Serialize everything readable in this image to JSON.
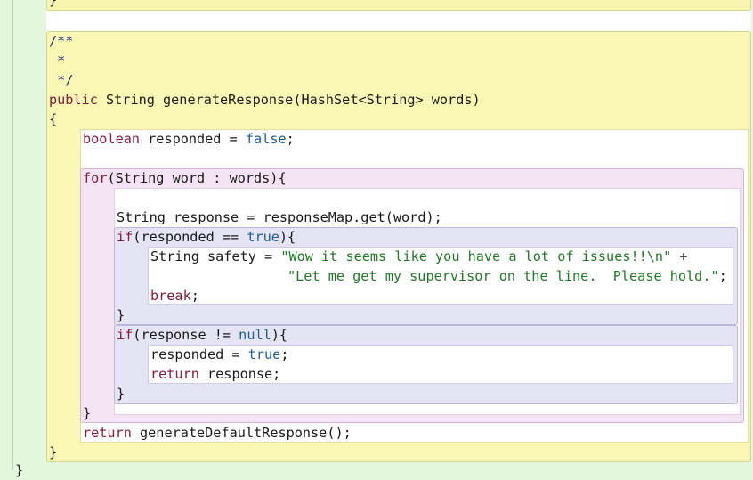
{
  "editor": {
    "prev_close_brace": "}",
    "comment_open": "/**",
    "comment_mid": " *",
    "comment_close": " */",
    "sig_public": "public",
    "sig_rest": " String generateResponse(HashSet<String> words)",
    "method_open": "{",
    "l1_kw": "boolean",
    "l1_mid": " responded = ",
    "l1_lit": "false",
    "l1_end": ";",
    "for_kw": "for",
    "for_rest": "(String word : words){",
    "resp_line": "String response = responseMap.get(word);",
    "if1_kw": "if",
    "if1_mid": "(responded == ",
    "if1_lit": "true",
    "if1_end": "){",
    "safety_pre": "String safety = ",
    "safety_str1": "\"Wow it seems like you have a lot of issues!!\\n\"",
    "safety_plus": " +",
    "safety_str2": "\"Let me get my supervisor on the line.  Please hold.\"",
    "safety_semi": ";",
    "break_kw": "break",
    "break_semi": ";",
    "if1_close": "}",
    "if2_kw": "if",
    "if2_mid": "(response != ",
    "if2_lit": "null",
    "if2_end": "){",
    "set_pre": "responded = ",
    "set_lit": "true",
    "set_semi": ";",
    "ret1_kw": "return",
    "ret1_rest": " response;",
    "if2_close": "}",
    "for_close": "}",
    "ret2_kw": "return",
    "ret2_rest": " generateDefaultResponse();",
    "method_close": "}",
    "class_close": "}"
  }
}
